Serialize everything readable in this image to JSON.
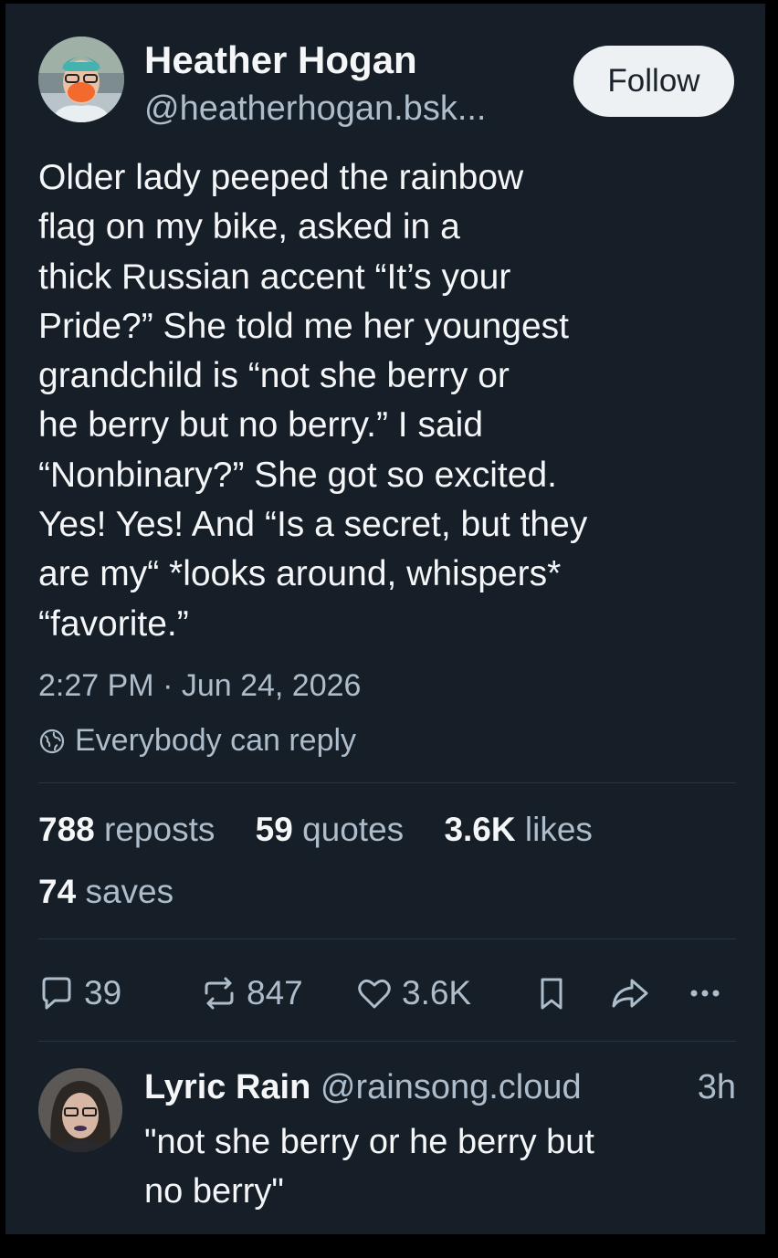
{
  "post": {
    "author_name": "Heather Hogan",
    "author_handle": "@heatherhogan.bsk...",
    "follow_label": "Follow",
    "text_lines": [
      "Older lady peeped the rainbow",
      "flag on my bike, asked in a",
      "thick Russian accent “It’s your",
      "Pride?” She told me her youngest",
      "grandchild is “not she berry or",
      "he berry but no berry.” I said",
      "“Nonbinary?” She got so excited.",
      "Yes! Yes! And “Is a secret, but they",
      "are my“ *looks around, whispers*",
      "“favorite.”"
    ],
    "timestamp": "2:27 PM · Jun 24, 2026",
    "reply_setting": "Everybody can reply",
    "reply_setting_icon": "globe-icon"
  },
  "stats": {
    "reposts_count": "788",
    "reposts_label": "reposts",
    "quotes_count": "59",
    "quotes_label": "quotes",
    "likes_count": "3.6K",
    "likes_label": "likes",
    "saves_count": "74",
    "saves_label": "saves"
  },
  "actions": {
    "reply_count": "39",
    "repost_count": "847",
    "like_count": "3.6K",
    "icons": [
      "reply-icon",
      "repost-icon",
      "heart-icon",
      "bookmark-icon",
      "share-icon",
      "more-icon"
    ]
  },
  "reply": {
    "author_name": "Lyric Rain",
    "author_handle": "@rainsong.cloud",
    "time": "3h",
    "text_lines": [
      "\"not she berry or he berry but",
      "no berry\""
    ]
  },
  "colors": {
    "background": "#161e27",
    "text_primary": "#f4f6f8",
    "text_secondary": "#aebdcb",
    "follow_button": "#eef1f3",
    "avatar_mask": "#f26a2e"
  }
}
